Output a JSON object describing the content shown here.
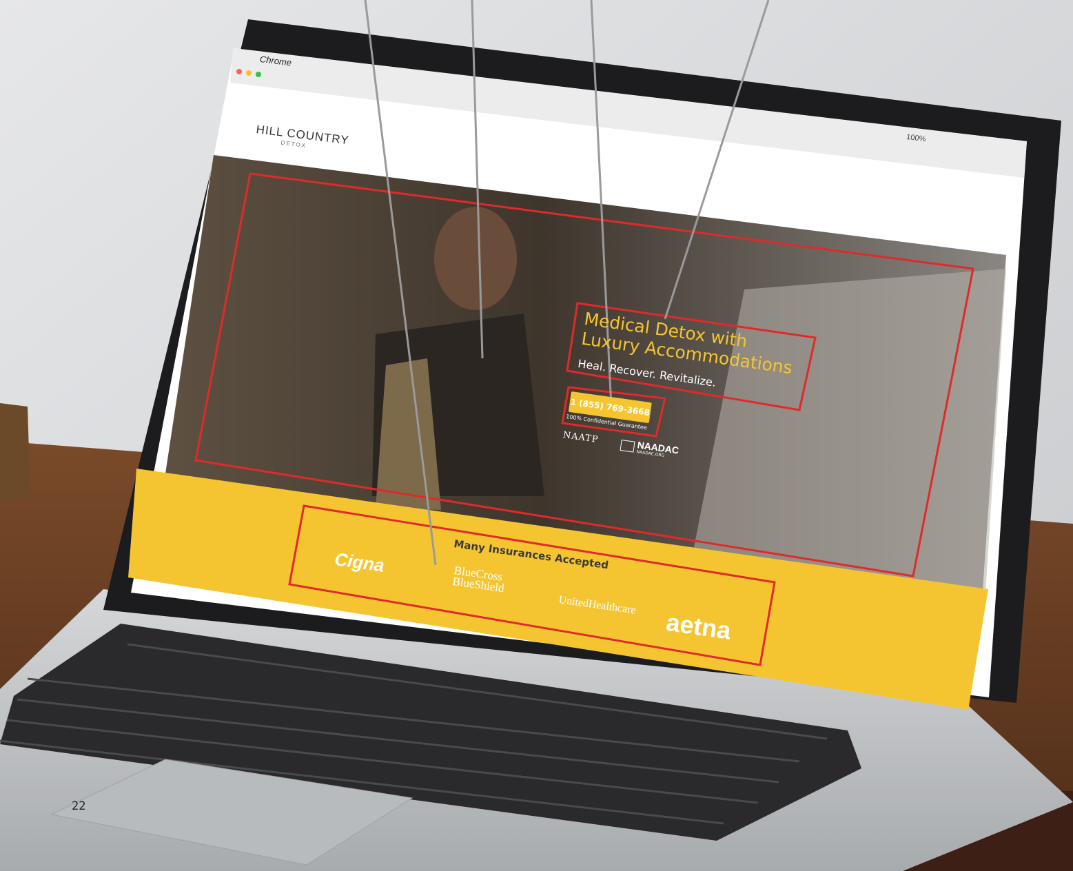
{
  "os_menubar": {
    "app_name": "Chrome",
    "status_right": "100%"
  },
  "browser": {
    "address_placeholder": "",
    "tab_close": "×"
  },
  "site": {
    "logo_main": "HILL COUNTRY",
    "logo_sub": "DETOX",
    "hero": {
      "headline_line1": "Medical Detox with",
      "headline_line2": "Luxury Accommodations",
      "subheadline": "Heal. Recover. Revitalize.",
      "phone": "1 (855) 769-3668",
      "phone_note": "100% Confidential Guarantee",
      "badge_naatp": "NAATP",
      "badge_naadac": "NAADAC",
      "badge_naadac_sub": "NAADAC.ORG"
    },
    "insurance": {
      "title": "Many Insurances Accepted",
      "logos": [
        "Cigna",
        "BlueCross BlueShield",
        "UnitedHealthcare",
        "aetna"
      ]
    }
  },
  "page_number": "22",
  "colors": {
    "brand_yellow": "#f5c531",
    "annotation_red": "#e02a2a",
    "callout_gray": "#9a9a9a"
  }
}
